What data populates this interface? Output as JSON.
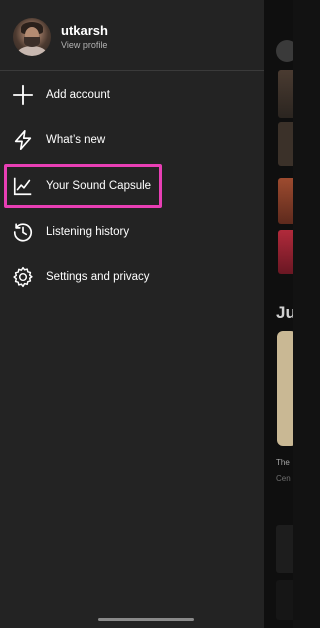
{
  "profile": {
    "username": "utkarsh",
    "view_profile": "View profile"
  },
  "menu": {
    "items": [
      {
        "label": "Add account",
        "icon": "plus-icon"
      },
      {
        "label": "What’s new",
        "icon": "lightning-icon"
      },
      {
        "label": "Your Sound Capsule",
        "icon": "trend-chart-icon"
      },
      {
        "label": "Listening history",
        "icon": "history-clock-icon"
      },
      {
        "label": "Settings and privacy",
        "icon": "gear-icon"
      }
    ],
    "highlight_color": "#e83fb4"
  },
  "background": {
    "heading": "Ju",
    "card_title": "The",
    "card_subtitle": "Cen"
  }
}
